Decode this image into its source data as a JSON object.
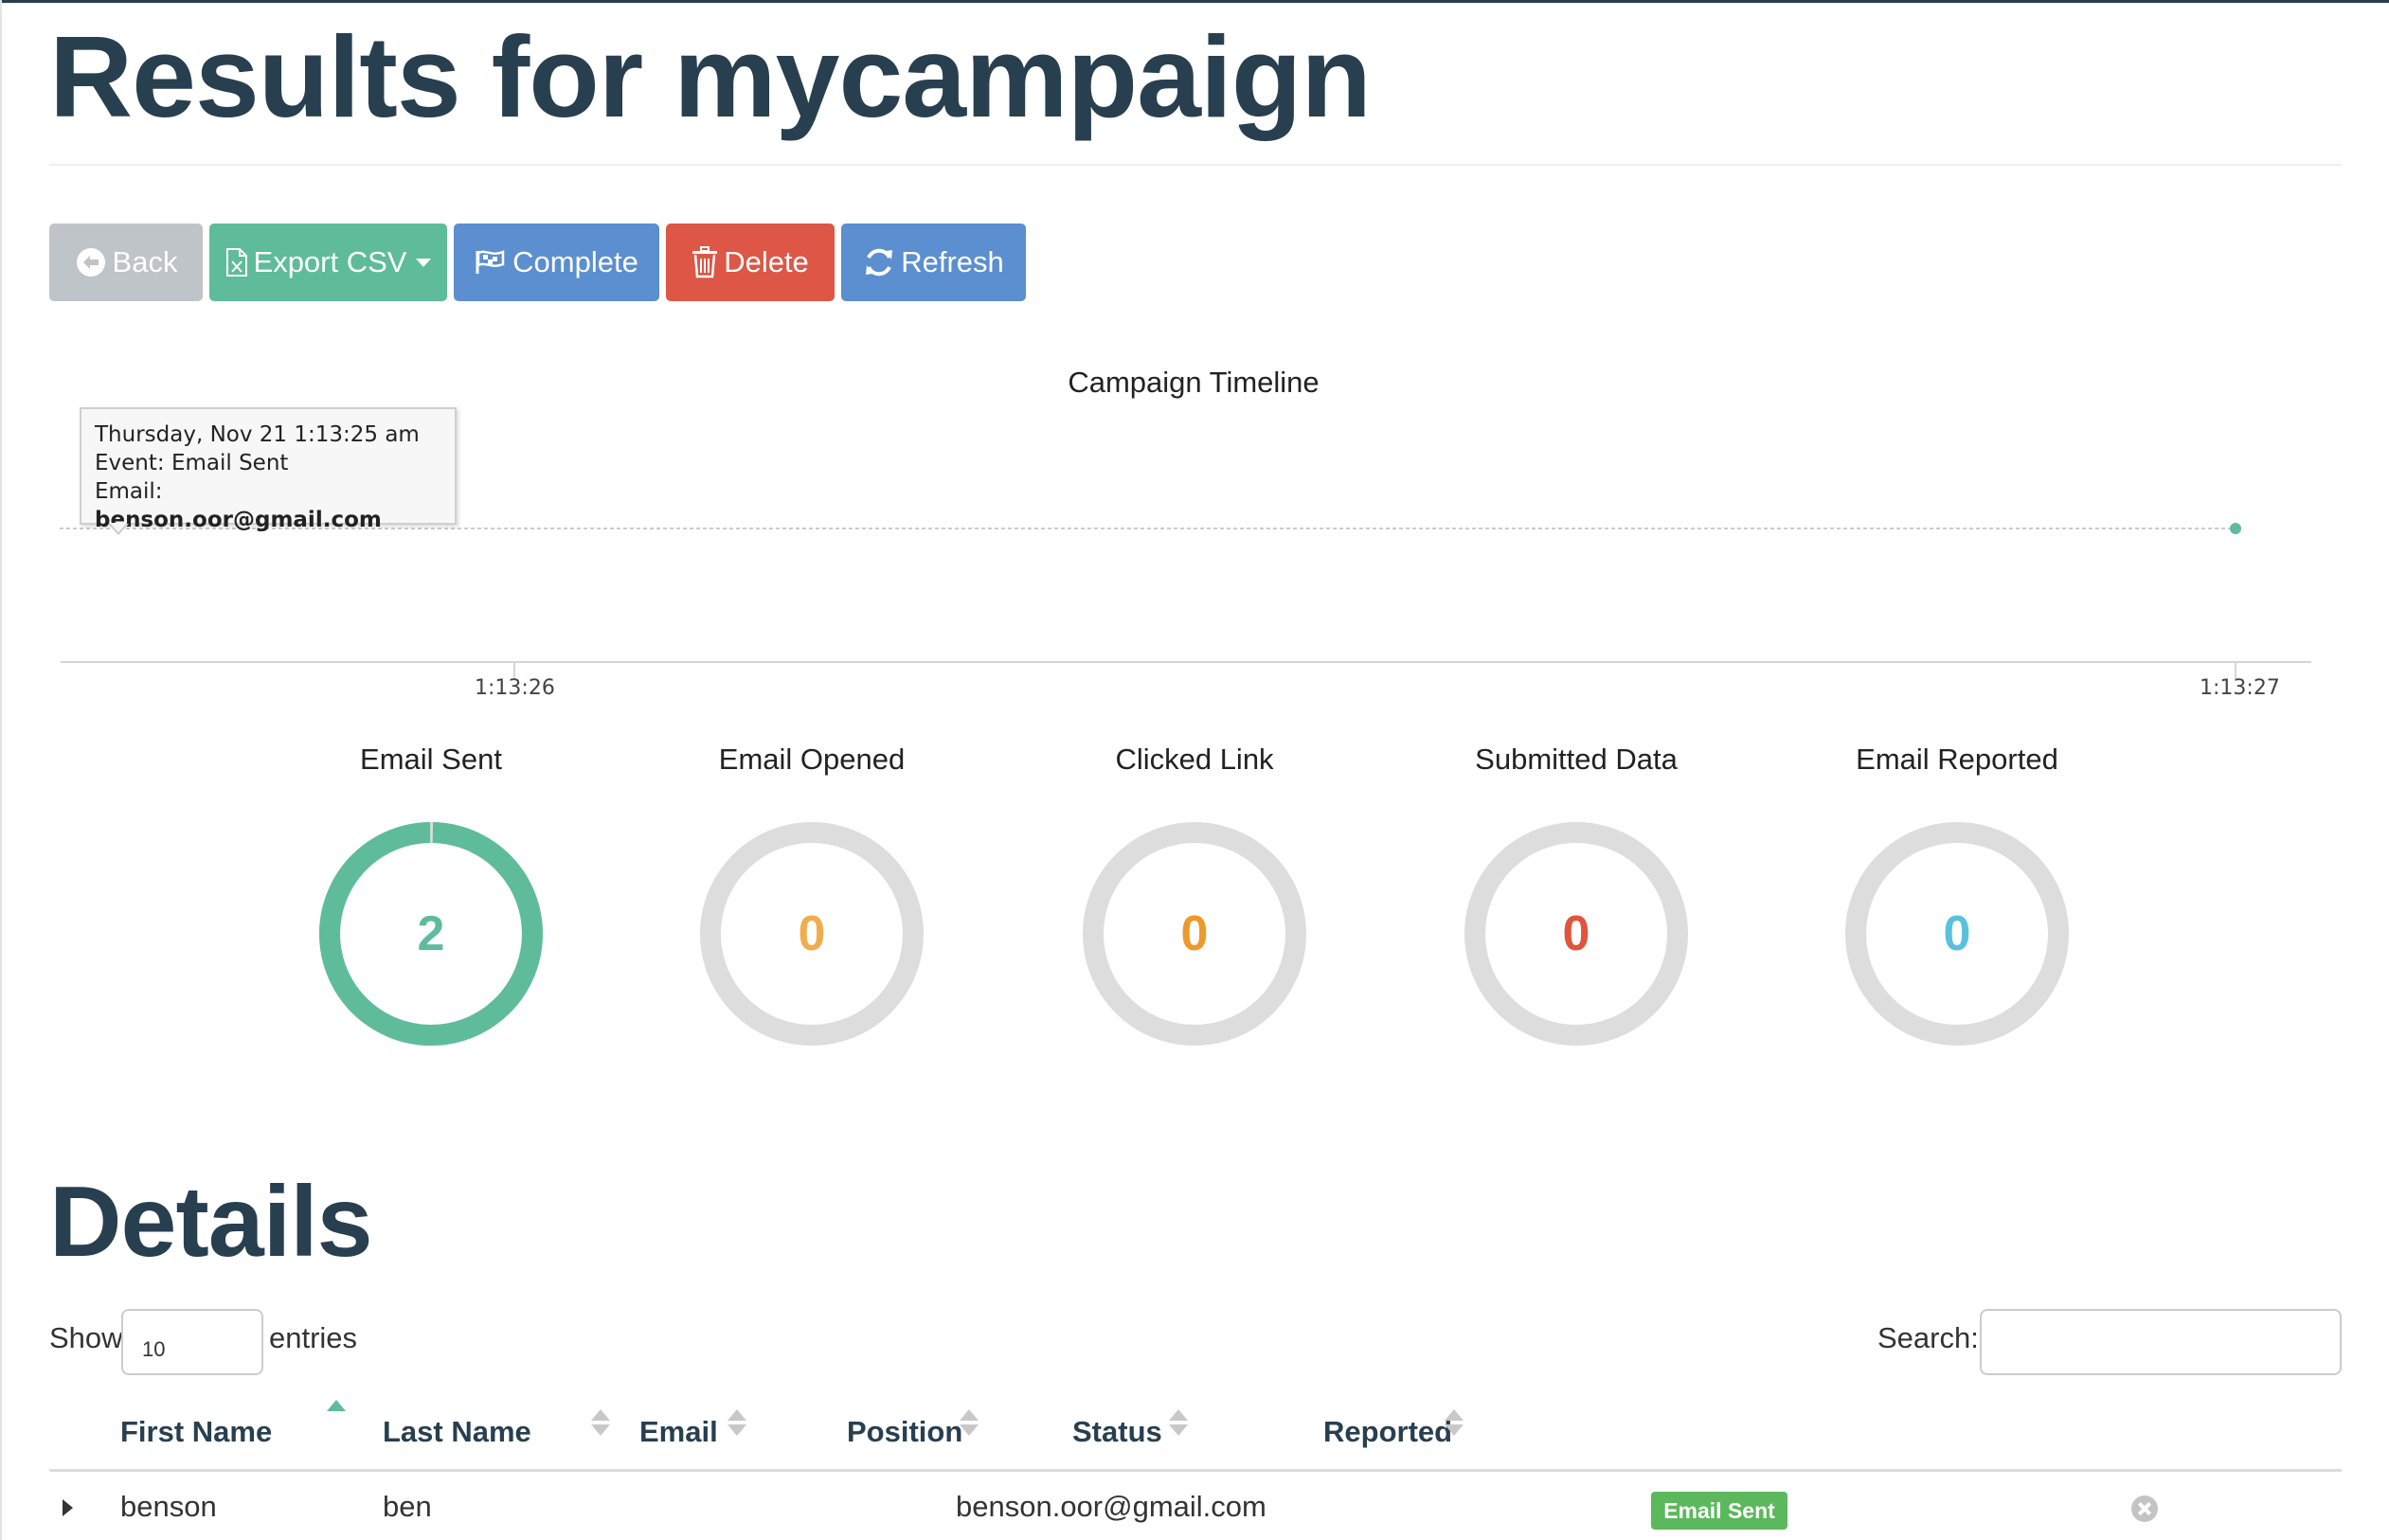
{
  "page": {
    "title": "Results for mycampaign"
  },
  "toolbar": {
    "back_label": "Back",
    "export_label": "Export CSV",
    "complete_label": "Complete",
    "delete_label": "Delete",
    "refresh_label": "Refresh"
  },
  "colors": {
    "dark": "#283f50",
    "green": "#5ebc9a",
    "blue": "#5b8fd0",
    "red": "#dd5646",
    "grey": "#bfc4c9",
    "orange": "#f0ad4e",
    "orange_dark": "#ec9a2a",
    "red_value": "#e0553c",
    "cyan": "#5bc0de"
  },
  "timeline": {
    "title": "Campaign Timeline",
    "tooltip": {
      "line1": "Thursday, Nov 21 1:13:25 am",
      "event_prefix": "Event: ",
      "event": "Email Sent",
      "email_prefix": "Email: ",
      "email": "benson.oor@gmail.com"
    },
    "ticks": [
      "1:13:26",
      "1:13:27"
    ]
  },
  "chart_data": {
    "type": "scatter",
    "title": "Campaign Timeline",
    "x": [
      "1:13:25",
      "1:13:27"
    ],
    "y": [
      1,
      1
    ],
    "x_ticks": [
      "1:13:26",
      "1:13:27"
    ],
    "grid": false
  },
  "stats": [
    {
      "label": "Email Sent",
      "value": "2",
      "fraction": 1.0,
      "color": "#5ebc9a"
    },
    {
      "label": "Email Opened",
      "value": "0",
      "fraction": 0,
      "color": "#f0ad4e"
    },
    {
      "label": "Clicked Link",
      "value": "0",
      "fraction": 0,
      "color": "#ec9a2a"
    },
    {
      "label": "Submitted Data",
      "value": "0",
      "fraction": 0,
      "color": "#e0553c"
    },
    {
      "label": "Email Reported",
      "value": "0",
      "fraction": 0,
      "color": "#5bc0de"
    }
  ],
  "details": {
    "title": "Details",
    "show_label": "Show",
    "entries_value": "10",
    "entries_label": "entries",
    "search_label": "Search:",
    "search_value": "",
    "columns": [
      "First Name",
      "Last Name",
      "Email",
      "Position",
      "Status",
      "Reported"
    ],
    "rows": [
      {
        "first_name": "benson",
        "last_name": "ben",
        "email": "benson.oor@gmail.com",
        "position": "",
        "status": "Email Sent",
        "reported": false
      }
    ]
  }
}
